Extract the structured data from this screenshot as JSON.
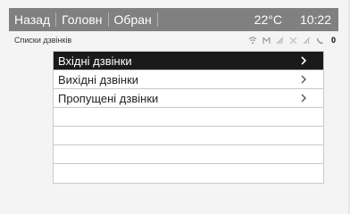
{
  "topbar": {
    "nav": [
      "Назад",
      "Головн",
      "Обран"
    ],
    "temperature": "22°C",
    "time": "10:22"
  },
  "subheader": {
    "title": "Списки дзвінків",
    "status_icons": [
      "bluetooth-signal-icon",
      "envelope-icon",
      "signal-bars-icon",
      "roaming-icon",
      "signal-strength-icon",
      "phone-icon"
    ],
    "badge": "0"
  },
  "list": {
    "items": [
      {
        "label": "Вхідні дзвінки",
        "selected": true
      },
      {
        "label": "Вихідні дзвінки",
        "selected": false
      },
      {
        "label": "Пропущені дзвінки",
        "selected": false
      },
      {
        "label": "",
        "selected": false
      },
      {
        "label": "",
        "selected": false
      },
      {
        "label": "",
        "selected": false
      },
      {
        "label": "",
        "selected": false
      }
    ]
  },
  "colors": {
    "topbar_bg": "#808080",
    "selected_bg": "#1a1a1a",
    "row_border": "#c9c9c9"
  }
}
